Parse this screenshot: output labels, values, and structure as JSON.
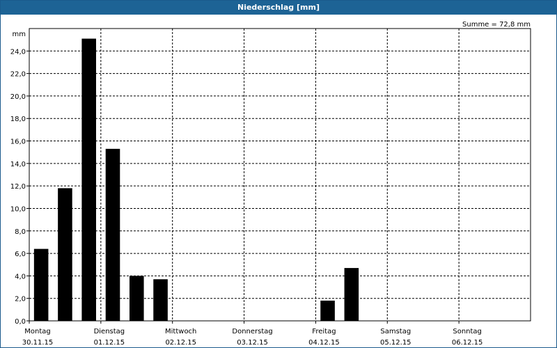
{
  "window": {
    "title": "Niederschlag [mm]"
  },
  "chart_data": {
    "type": "bar",
    "title": "Niederschlag [mm]",
    "unit_label": "mm",
    "sum_label": "Summe = 72,8 mm",
    "ylim": [
      0,
      26
    ],
    "y_ticks": [
      "0,0",
      "2,0",
      "4,0",
      "6,0",
      "8,0",
      "10,0",
      "12,0",
      "14,0",
      "16,0",
      "18,0",
      "20,0",
      "22,0",
      "24,0"
    ],
    "y_tick_values": [
      0,
      2,
      4,
      6,
      8,
      10,
      12,
      14,
      16,
      18,
      20,
      22,
      24
    ],
    "days": [
      {
        "name": "Montag",
        "date": "30.11.15"
      },
      {
        "name": "Dienstag",
        "date": "01.12.15"
      },
      {
        "name": "Mittwoch",
        "date": "02.12.15"
      },
      {
        "name": "Donnerstag",
        "date": "03.12.15"
      },
      {
        "name": "Freitag",
        "date": "04.12.15"
      },
      {
        "name": "Samstag",
        "date": "05.12.15"
      },
      {
        "name": "Sonntag",
        "date": "06.12.15"
      }
    ],
    "bars_per_day": 3,
    "values": [
      6.4,
      11.8,
      25.1,
      15.3,
      4.0,
      3.7,
      0,
      0,
      0,
      0,
      0,
      0,
      1.8,
      4.7,
      0,
      0,
      0,
      0,
      0,
      0,
      0
    ],
    "bar_color": "#000000",
    "grid": true
  }
}
